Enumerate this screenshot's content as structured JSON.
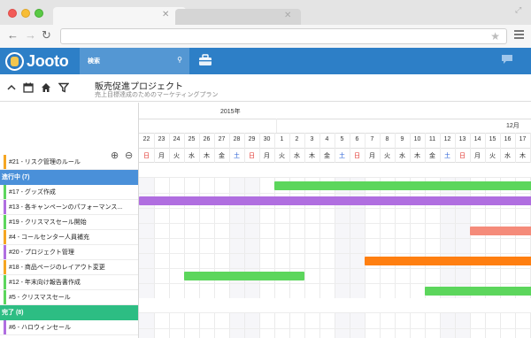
{
  "app": {
    "logo_text": "Jooto",
    "search_label": "検索"
  },
  "project": {
    "title": "販売促進プロジェクト",
    "subtitle": "売上目標達成のためのマーケティングプラン"
  },
  "calendar": {
    "year_label": "2015年",
    "month_label": "12月",
    "days": [
      {
        "d": "22",
        "w": "日",
        "color": "red"
      },
      {
        "d": "23",
        "w": "月",
        "color": "normal"
      },
      {
        "d": "24",
        "w": "火",
        "color": "normal"
      },
      {
        "d": "25",
        "w": "水",
        "color": "normal"
      },
      {
        "d": "26",
        "w": "木",
        "color": "normal"
      },
      {
        "d": "27",
        "w": "金",
        "color": "normal"
      },
      {
        "d": "28",
        "w": "土",
        "color": "blue"
      },
      {
        "d": "29",
        "w": "日",
        "color": "red"
      },
      {
        "d": "30",
        "w": "月",
        "color": "normal"
      },
      {
        "d": "1",
        "w": "火",
        "color": "normal"
      },
      {
        "d": "2",
        "w": "水",
        "color": "normal"
      },
      {
        "d": "3",
        "w": "木",
        "color": "normal"
      },
      {
        "d": "4",
        "w": "金",
        "color": "normal"
      },
      {
        "d": "5",
        "w": "土",
        "color": "blue"
      },
      {
        "d": "6",
        "w": "日",
        "color": "red"
      },
      {
        "d": "7",
        "w": "月",
        "color": "normal"
      },
      {
        "d": "8",
        "w": "火",
        "color": "normal"
      },
      {
        "d": "9",
        "w": "水",
        "color": "normal"
      },
      {
        "d": "10",
        "w": "木",
        "color": "normal"
      },
      {
        "d": "11",
        "w": "金",
        "color": "normal"
      },
      {
        "d": "12",
        "w": "土",
        "color": "blue"
      },
      {
        "d": "13",
        "w": "日",
        "color": "red"
      },
      {
        "d": "14",
        "w": "月",
        "color": "normal"
      },
      {
        "d": "15",
        "w": "火",
        "color": "normal"
      },
      {
        "d": "16",
        "w": "水",
        "color": "normal"
      },
      {
        "d": "17",
        "w": "木",
        "color": "normal"
      }
    ]
  },
  "rows": [
    {
      "kind": "task",
      "label": "#21 - リスク管理のルール",
      "stripe": "#f5a623",
      "bar": null
    },
    {
      "kind": "group",
      "label": "進行中 (7)",
      "color": "#4a90d9"
    },
    {
      "kind": "task",
      "label": "#17 - グッズ作成",
      "stripe": "#5cd65c",
      "bar": {
        "start": 9,
        "end": 27,
        "color": "#5cd65c"
      }
    },
    {
      "kind": "task",
      "label": "#13 - 各キャンペーンのパフォーマンス...",
      "stripe": "#b06ee0",
      "bar": {
        "start": 0,
        "end": 27,
        "color": "#b06ee0"
      }
    },
    {
      "kind": "task",
      "label": "#19 - クリスマスセール開始",
      "stripe": "#5cd65c",
      "bar": null
    },
    {
      "kind": "task",
      "label": "#4 - コールセンター人員補充",
      "stripe": "#f5a623",
      "bar": {
        "start": 22,
        "end": 27,
        "color": "#f58b7a"
      }
    },
    {
      "kind": "task",
      "label": "#20 - プロジェクト管理",
      "stripe": "#b06ee0",
      "bar": null
    },
    {
      "kind": "task",
      "label": "#18 - 商品ページのレイアウト変更",
      "stripe": "#f5a623",
      "bar": {
        "start": 15,
        "end": 27,
        "color": "#ff7f11"
      }
    },
    {
      "kind": "task",
      "label": "#12 - 年末向け報告書作成",
      "stripe": "#5cd65c",
      "bar": {
        "start": 3,
        "end": 10,
        "color": "#5cd65c"
      }
    },
    {
      "kind": "task",
      "label": "#5 - クリスマスセール",
      "stripe": "#5cd65c",
      "bar": {
        "start": 19,
        "end": 27,
        "color": "#5cd65c"
      }
    },
    {
      "kind": "group",
      "label": "完了 (8)",
      "color": "#2dbd83"
    },
    {
      "kind": "task",
      "label": "#6 - ハロウィンセール",
      "stripe": "#b06ee0",
      "bar": null
    }
  ]
}
